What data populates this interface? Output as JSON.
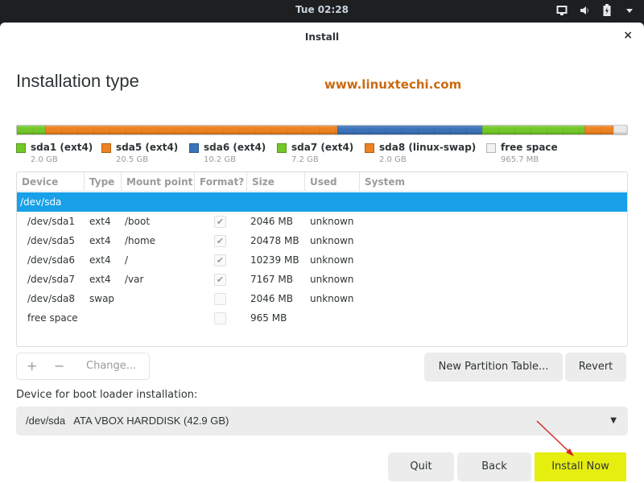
{
  "topbar": {
    "clock": "Tue 02:28",
    "tray_icons": [
      "screen-icon",
      "volume-icon",
      "battery-icon",
      "menu-arrow-icon"
    ]
  },
  "window": {
    "title": "Install",
    "close_glyph": "×"
  },
  "page": {
    "heading": "Installation type",
    "watermark": "www.linuxtechi.com"
  },
  "partition_bar": {
    "segments": [
      {
        "name": "sda1",
        "color": "#73c829",
        "gb": 2.0
      },
      {
        "name": "sda5",
        "color": "#ed8221",
        "gb": 20.5
      },
      {
        "name": "sda6",
        "color": "#3b73b9",
        "gb": 10.2
      },
      {
        "name": "sda7",
        "color": "#73c829",
        "gb": 7.2
      },
      {
        "name": "sda8",
        "color": "#ed8221",
        "gb": 2.0
      },
      {
        "name": "free",
        "color": "#e9e9e9",
        "gb": 0.97
      }
    ]
  },
  "legend": [
    {
      "label": "sda1 (ext4)",
      "size": "2.0 GB",
      "color": "#73c829"
    },
    {
      "label": "sda5 (ext4)",
      "size": "20.5 GB",
      "color": "#ed8221"
    },
    {
      "label": "sda6 (ext4)",
      "size": "10.2 GB",
      "color": "#3b73b9"
    },
    {
      "label": "sda7 (ext4)",
      "size": "7.2 GB",
      "color": "#73c829"
    },
    {
      "label": "sda8 (linux-swap)",
      "size": "2.0 GB",
      "color": "#ed8221"
    },
    {
      "label": "free space",
      "size": "965.7 MB",
      "color": "#f2f2f2"
    }
  ],
  "table": {
    "headers": [
      "Device",
      "Type",
      "Mount point",
      "Format?",
      "Size",
      "Used",
      "System"
    ],
    "disk_row": "/dev/sda",
    "rows": [
      {
        "device": "/dev/sda1",
        "type": "ext4",
        "mount": "/boot",
        "format": true,
        "size": "2046 MB",
        "used": "unknown"
      },
      {
        "device": "/dev/sda5",
        "type": "ext4",
        "mount": "/home",
        "format": true,
        "size": "20478 MB",
        "used": "unknown"
      },
      {
        "device": "/dev/sda6",
        "type": "ext4",
        "mount": "/",
        "format": true,
        "size": "10239 MB",
        "used": "unknown"
      },
      {
        "device": "/dev/sda7",
        "type": "ext4",
        "mount": "/var",
        "format": true,
        "size": "7167 MB",
        "used": "unknown"
      },
      {
        "device": "/dev/sda8",
        "type": "swap",
        "mount": "",
        "format": false,
        "size": "2046 MB",
        "used": "unknown"
      },
      {
        "device": "free space",
        "type": "",
        "mount": "",
        "format": false,
        "size": "965 MB",
        "used": ""
      }
    ],
    "check_glyph": "✔"
  },
  "tools": {
    "add": "+",
    "remove": "−",
    "change": "Change..."
  },
  "buttons": {
    "new_partition_table": "New Partition Table...",
    "revert": "Revert",
    "quit": "Quit",
    "back": "Back",
    "install_now": "Install Now"
  },
  "bootloader": {
    "label": "Device for boot loader installation:",
    "value": "/dev/sda   ATA VBOX HARDDISK (42.9 GB)",
    "arrow": "▼"
  },
  "colors": {
    "selection": "#18a0e8",
    "install_button": "#e6ee0f",
    "annotation_arrow": "#d42a2a"
  }
}
